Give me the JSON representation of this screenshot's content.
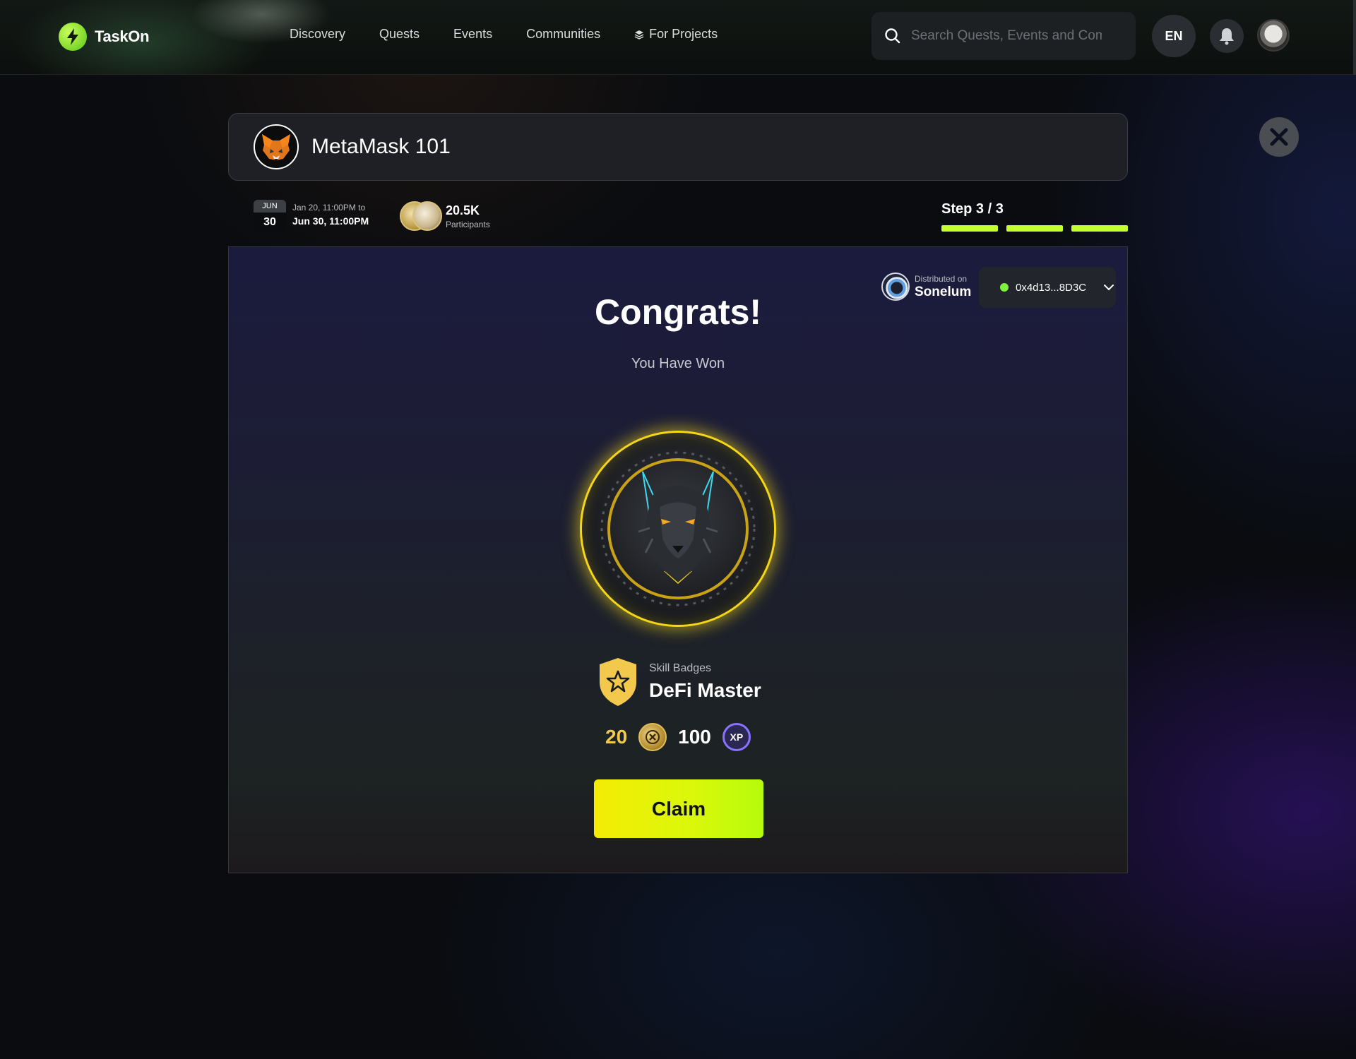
{
  "nav": {
    "logo": "TaskOn",
    "links": [
      "Discovery",
      "Quests",
      "Events",
      "Communities",
      "For Projects"
    ],
    "search_placeholder": "Search Quests, Events and Communities",
    "lang": "EN"
  },
  "quest": {
    "title": "MetaMask 101",
    "date_month": "JUN",
    "date_day": "30",
    "date_from": "Jan 20, 11:00PM to",
    "date_to": "Jun 30, 11:00PM",
    "participants_count": "20.5K",
    "participants_label": "Participants",
    "step_label": "Step 3 / 3",
    "steps_total": 3,
    "steps_done": 3
  },
  "reward": {
    "distributed_label": "Distributed on",
    "network": "Sonelum",
    "wallet": "0x4d13...8D3C",
    "title": "Congrats!",
    "subtitle": "You Have Won",
    "badge_category": "Skill Badges",
    "badge_name": "DeFi Master",
    "gold_amount": "20",
    "xp_amount": "100",
    "xp_icon_label": "XP",
    "claim_label": "Claim"
  },
  "colors": {
    "accent_green": "#c4ff2e",
    "gold": "#f2c94c",
    "badge_glow": "#f6d718"
  }
}
